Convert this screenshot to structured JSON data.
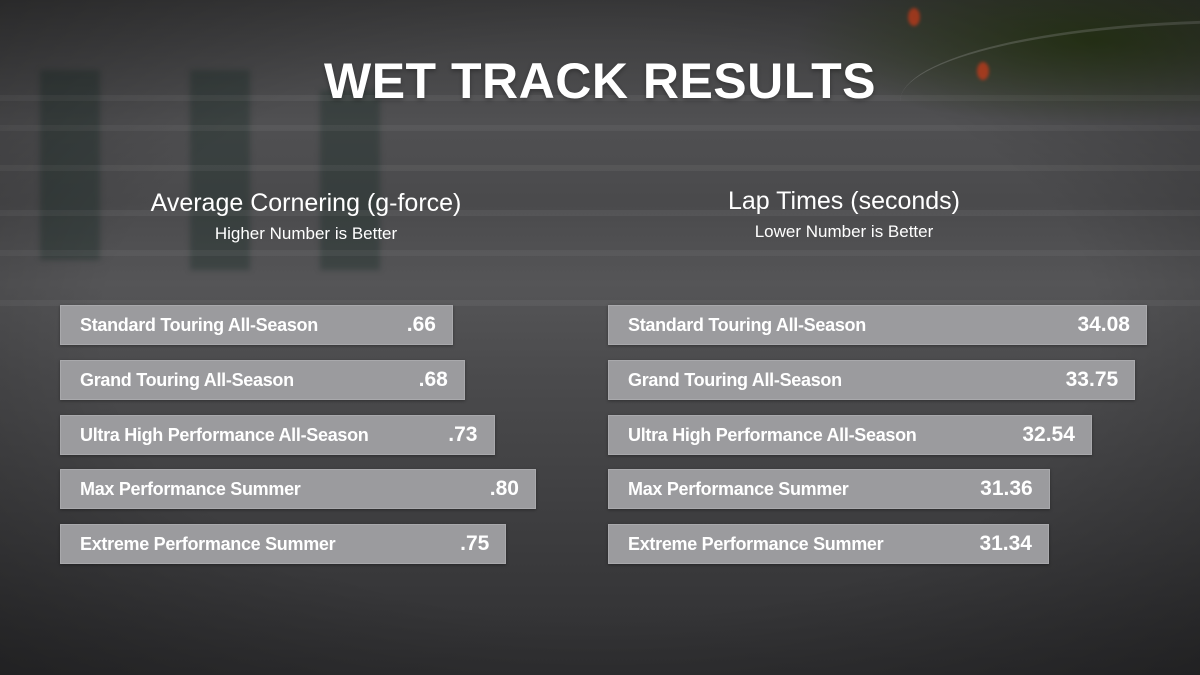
{
  "title": "WET TRACK RESULTS",
  "chart_data": [
    {
      "type": "bar",
      "orientation": "horizontal",
      "title": "Average Cornering (g-force)",
      "subtitle": "Higher Number is Better",
      "categories": [
        "Standard Touring All-Season",
        "Grand Touring All-Season",
        "Ultra High Performance All-Season",
        "Max Performance Summer",
        "Extreme Performance Summer"
      ],
      "values": [
        0.66,
        0.68,
        0.73,
        0.8,
        0.75
      ],
      "value_labels": [
        ".66",
        ".68",
        ".73",
        ".80",
        ".75"
      ],
      "xlabel": "",
      "ylabel": "",
      "grid": false
    },
    {
      "type": "bar",
      "orientation": "horizontal",
      "title": "Lap Times (seconds)",
      "subtitle": "Lower Number is Better",
      "categories": [
        "Standard Touring All-Season",
        "Grand Touring All-Season",
        "Ultra High Performance All-Season",
        "Max Performance Summer",
        "Extreme Performance Summer"
      ],
      "values": [
        34.08,
        33.75,
        32.54,
        31.36,
        31.34
      ],
      "value_labels": [
        "34.08",
        "33.75",
        "32.54",
        "31.36",
        "31.34"
      ],
      "xlabel": "",
      "ylabel": "",
      "grid": false
    }
  ],
  "colors": {
    "bar_fill": "#9b9b9e",
    "text": "#ffffff"
  }
}
